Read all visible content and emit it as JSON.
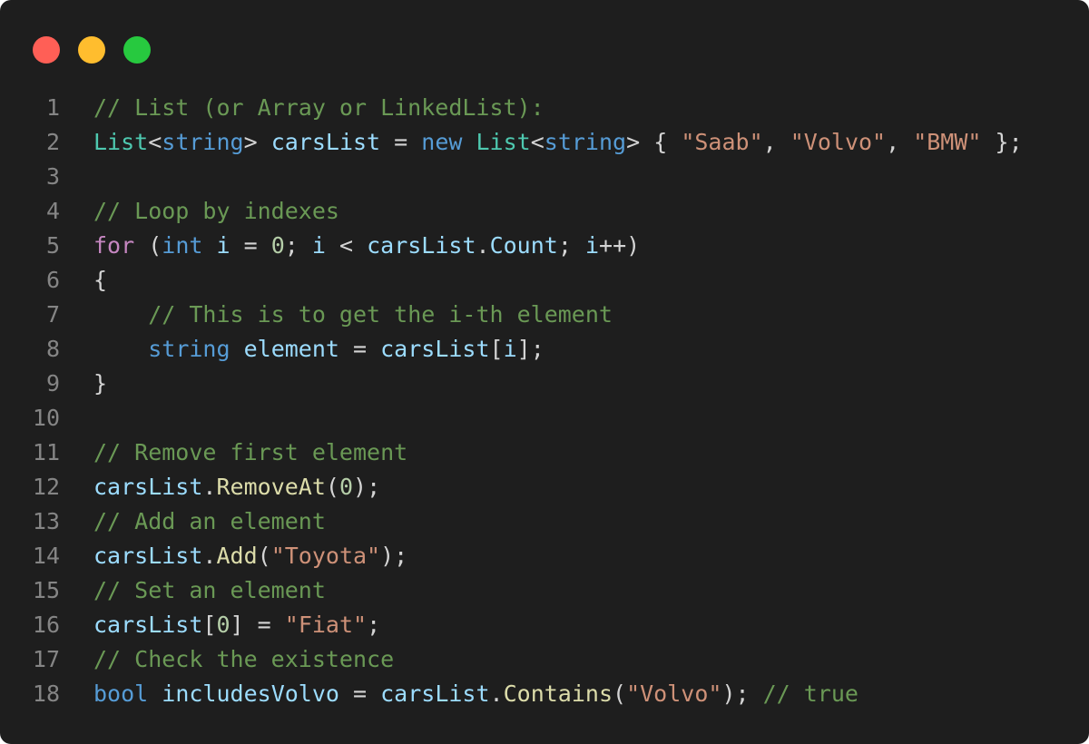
{
  "window": {
    "buttons": [
      {
        "name": "close",
        "color": "#ff5f56"
      },
      {
        "name": "minimize",
        "color": "#ffbd2e"
      },
      {
        "name": "maximize",
        "color": "#27c93f"
      }
    ]
  },
  "editor": {
    "language": "csharp",
    "theme_colors": {
      "background": "#1e1e1e",
      "line_number": "#858585",
      "comment": "#6a9955",
      "type": "#4ec9b0",
      "keyword": "#569cd6",
      "control": "#c586c0",
      "string": "#ce9178",
      "variable": "#9cdcfe",
      "function": "#dcdcaa",
      "number": "#b5cea8",
      "plain": "#d4d4d4"
    },
    "lines": [
      {
        "number": "1",
        "tokens": [
          [
            "comment",
            "// List (or Array or LinkedList):"
          ]
        ]
      },
      {
        "number": "2",
        "tokens": [
          [
            "type",
            "List"
          ],
          [
            "plain",
            "<"
          ],
          [
            "keyword",
            "string"
          ],
          [
            "plain",
            "> "
          ],
          [
            "variable",
            "carsList"
          ],
          [
            "plain",
            " = "
          ],
          [
            "keyword",
            "new"
          ],
          [
            "plain",
            " "
          ],
          [
            "type",
            "List"
          ],
          [
            "plain",
            "<"
          ],
          [
            "keyword",
            "string"
          ],
          [
            "plain",
            "> { "
          ],
          [
            "string",
            "\"Saab\""
          ],
          [
            "plain",
            ", "
          ],
          [
            "string",
            "\"Volvo\""
          ],
          [
            "plain",
            ", "
          ],
          [
            "string",
            "\"BMW\""
          ],
          [
            "plain",
            " };"
          ]
        ]
      },
      {
        "number": "3",
        "tokens": []
      },
      {
        "number": "4",
        "tokens": [
          [
            "comment",
            "// Loop by indexes"
          ]
        ]
      },
      {
        "number": "5",
        "tokens": [
          [
            "control",
            "for"
          ],
          [
            "plain",
            " ("
          ],
          [
            "keyword",
            "int"
          ],
          [
            "plain",
            " "
          ],
          [
            "variable",
            "i"
          ],
          [
            "plain",
            " = "
          ],
          [
            "number",
            "0"
          ],
          [
            "plain",
            "; "
          ],
          [
            "variable",
            "i"
          ],
          [
            "plain",
            " < "
          ],
          [
            "variable",
            "carsList"
          ],
          [
            "plain",
            "."
          ],
          [
            "variable",
            "Count"
          ],
          [
            "plain",
            "; "
          ],
          [
            "variable",
            "i"
          ],
          [
            "plain",
            "++)"
          ]
        ]
      },
      {
        "number": "6",
        "tokens": [
          [
            "plain",
            "{"
          ]
        ]
      },
      {
        "number": "7",
        "tokens": [
          [
            "plain",
            "    "
          ],
          [
            "comment",
            "// This is to get the i-th element"
          ]
        ]
      },
      {
        "number": "8",
        "tokens": [
          [
            "plain",
            "    "
          ],
          [
            "keyword",
            "string"
          ],
          [
            "plain",
            " "
          ],
          [
            "variable",
            "element"
          ],
          [
            "plain",
            " = "
          ],
          [
            "variable",
            "carsList"
          ],
          [
            "plain",
            "["
          ],
          [
            "variable",
            "i"
          ],
          [
            "plain",
            "];"
          ]
        ]
      },
      {
        "number": "9",
        "tokens": [
          [
            "plain",
            "}"
          ]
        ]
      },
      {
        "number": "10",
        "tokens": []
      },
      {
        "number": "11",
        "tokens": [
          [
            "comment",
            "// Remove first element"
          ]
        ]
      },
      {
        "number": "12",
        "tokens": [
          [
            "variable",
            "carsList"
          ],
          [
            "plain",
            "."
          ],
          [
            "function",
            "RemoveAt"
          ],
          [
            "plain",
            "("
          ],
          [
            "number",
            "0"
          ],
          [
            "plain",
            ");"
          ]
        ]
      },
      {
        "number": "13",
        "tokens": [
          [
            "comment",
            "// Add an element"
          ]
        ]
      },
      {
        "number": "14",
        "tokens": [
          [
            "variable",
            "carsList"
          ],
          [
            "plain",
            "."
          ],
          [
            "function",
            "Add"
          ],
          [
            "plain",
            "("
          ],
          [
            "string",
            "\"Toyota\""
          ],
          [
            "plain",
            ");"
          ]
        ]
      },
      {
        "number": "15",
        "tokens": [
          [
            "comment",
            "// Set an element"
          ]
        ]
      },
      {
        "number": "16",
        "tokens": [
          [
            "variable",
            "carsList"
          ],
          [
            "plain",
            "["
          ],
          [
            "number",
            "0"
          ],
          [
            "plain",
            "] = "
          ],
          [
            "string",
            "\"Fiat\""
          ],
          [
            "plain",
            ";"
          ]
        ]
      },
      {
        "number": "17",
        "tokens": [
          [
            "comment",
            "// Check the existence"
          ]
        ]
      },
      {
        "number": "18",
        "tokens": [
          [
            "keyword",
            "bool"
          ],
          [
            "plain",
            " "
          ],
          [
            "variable",
            "includesVolvo"
          ],
          [
            "plain",
            " = "
          ],
          [
            "variable",
            "carsList"
          ],
          [
            "plain",
            "."
          ],
          [
            "function",
            "Contains"
          ],
          [
            "plain",
            "("
          ],
          [
            "string",
            "\"Volvo\""
          ],
          [
            "plain",
            "); "
          ],
          [
            "comment",
            "// true"
          ]
        ]
      }
    ]
  }
}
